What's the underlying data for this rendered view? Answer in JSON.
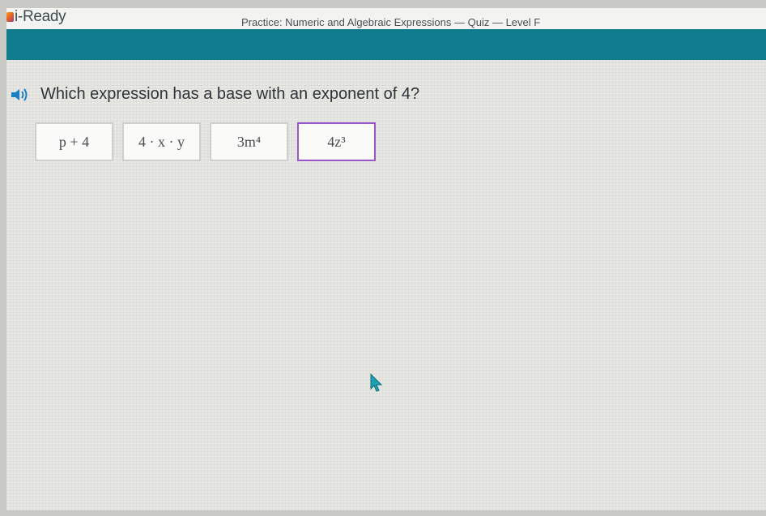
{
  "header": {
    "app_name": "i-Ready",
    "breadcrumb": "Practice: Numeric and Algebraic Expressions — Quiz — Level F"
  },
  "question": {
    "text": "Which expression has a base with an exponent of 4?",
    "audio_icon": "speaker-icon"
  },
  "choices": [
    {
      "label": "p + 4",
      "selected": false
    },
    {
      "label": "4 · x · y",
      "selected": false
    },
    {
      "label": "3m⁴",
      "selected": false
    },
    {
      "label": "4z³",
      "selected": true
    }
  ],
  "colors": {
    "header_band": "#0f7b8c",
    "selected_border": "#9a56c8",
    "audio_icon": "#1a7fc4"
  }
}
